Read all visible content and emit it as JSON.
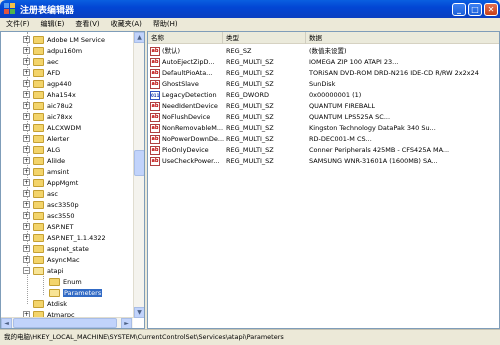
{
  "window": {
    "title": "注册表编辑器",
    "controls": {
      "minimize": "_",
      "maximize": "□",
      "close": "✕"
    }
  },
  "menu": {
    "items": [
      "文件(F)",
      "编辑(E)",
      "查看(V)",
      "收藏夹(A)",
      "帮助(H)"
    ]
  },
  "tree": {
    "items": [
      {
        "label": "Adobe LM Service",
        "expander": "+"
      },
      {
        "label": "adpu160m",
        "expander": "+"
      },
      {
        "label": "aec",
        "expander": "+"
      },
      {
        "label": "AFD",
        "expander": "+"
      },
      {
        "label": "agp440",
        "expander": "+"
      },
      {
        "label": "Aha154x",
        "expander": "+"
      },
      {
        "label": "aic78u2",
        "expander": "+"
      },
      {
        "label": "aic78xx",
        "expander": "+"
      },
      {
        "label": "ALCXWDM",
        "expander": "+"
      },
      {
        "label": "Alerter",
        "expander": "+"
      },
      {
        "label": "ALG",
        "expander": "+"
      },
      {
        "label": "AliIde",
        "expander": "+"
      },
      {
        "label": "amsint",
        "expander": "+"
      },
      {
        "label": "AppMgmt",
        "expander": "+"
      },
      {
        "label": "asc",
        "expander": "+"
      },
      {
        "label": "asc3350p",
        "expander": "+"
      },
      {
        "label": "asc3550",
        "expander": "+"
      },
      {
        "label": "ASP.NET",
        "expander": "+"
      },
      {
        "label": "ASP.NET_1.1.4322",
        "expander": "+"
      },
      {
        "label": "aspnet_state",
        "expander": "+"
      },
      {
        "label": "AsyncMac",
        "expander": "+"
      },
      {
        "label": "atapi",
        "expander": "−"
      },
      {
        "label": "Enum",
        "expander": ""
      },
      {
        "label": "Parameters",
        "expander": ""
      },
      {
        "label": "Atdisk",
        "expander": ""
      },
      {
        "label": "Atmarpc",
        "expander": "+"
      },
      {
        "label": "AudioSrv",
        "expander": "+"
      }
    ]
  },
  "list": {
    "headers": {
      "name": "名称",
      "type": "类型",
      "data": "数据"
    },
    "rows": [
      {
        "icon": "ab",
        "name": "(默认)",
        "type": "REG_SZ",
        "data": "(数值未设置)"
      },
      {
        "icon": "ab",
        "name": "AutoEjectZipD...",
        "type": "REG_MULTI_SZ",
        "data": "IOMEGA  ZIP 100         ATAPI           23..."
      },
      {
        "icon": "ab",
        "name": "DefaultPioAta...",
        "type": "REG_MULTI_SZ",
        "data": "TORiSAN DVD-ROM DRD-N216 IDE-CD R/RW 2x2x24"
      },
      {
        "icon": "ab",
        "name": "GhostSlave",
        "type": "REG_MULTI_SZ",
        "data": "SunDisk"
      },
      {
        "icon": "011",
        "name": "LegacyDetection",
        "type": "REG_DWORD",
        "data": "0x00000001 (1)"
      },
      {
        "icon": "ab",
        "name": "NeedIdentDevice",
        "type": "REG_MULTI_SZ",
        "data": "QUANTUM FIREBALL"
      },
      {
        "icon": "ab",
        "name": "NoFlushDevice",
        "type": "REG_MULTI_SZ",
        "data": "QUANTUM LPS525A                              SC..."
      },
      {
        "icon": "ab",
        "name": "NonRemovableM...",
        "type": "REG_MULTI_SZ",
        "data": "Kingston Technology DataPak 340          Su..."
      },
      {
        "icon": "ab",
        "name": "NoPowerDownDe...",
        "type": "REG_MULTI_SZ",
        "data": "RD-DEC001-M                               CS..."
      },
      {
        "icon": "ab",
        "name": "PioOnlyDevice",
        "type": "REG_MULTI_SZ",
        "data": "Conner Peripherals 425MB - CFS425A       MA..."
      },
      {
        "icon": "ab",
        "name": "UseCheckPower...",
        "type": "REG_MULTI_SZ",
        "data": "SAMSUNG WNR-31601A (1600MB)               SA..."
      }
    ]
  },
  "status": {
    "path": "我的电脑\\HKEY_LOCAL_MACHINE\\SYSTEM\\CurrentControlSet\\Services\\atapi\\Parameters"
  },
  "scrollbars": {
    "up": "▲",
    "down": "▼",
    "left": "◄",
    "right": "►"
  }
}
